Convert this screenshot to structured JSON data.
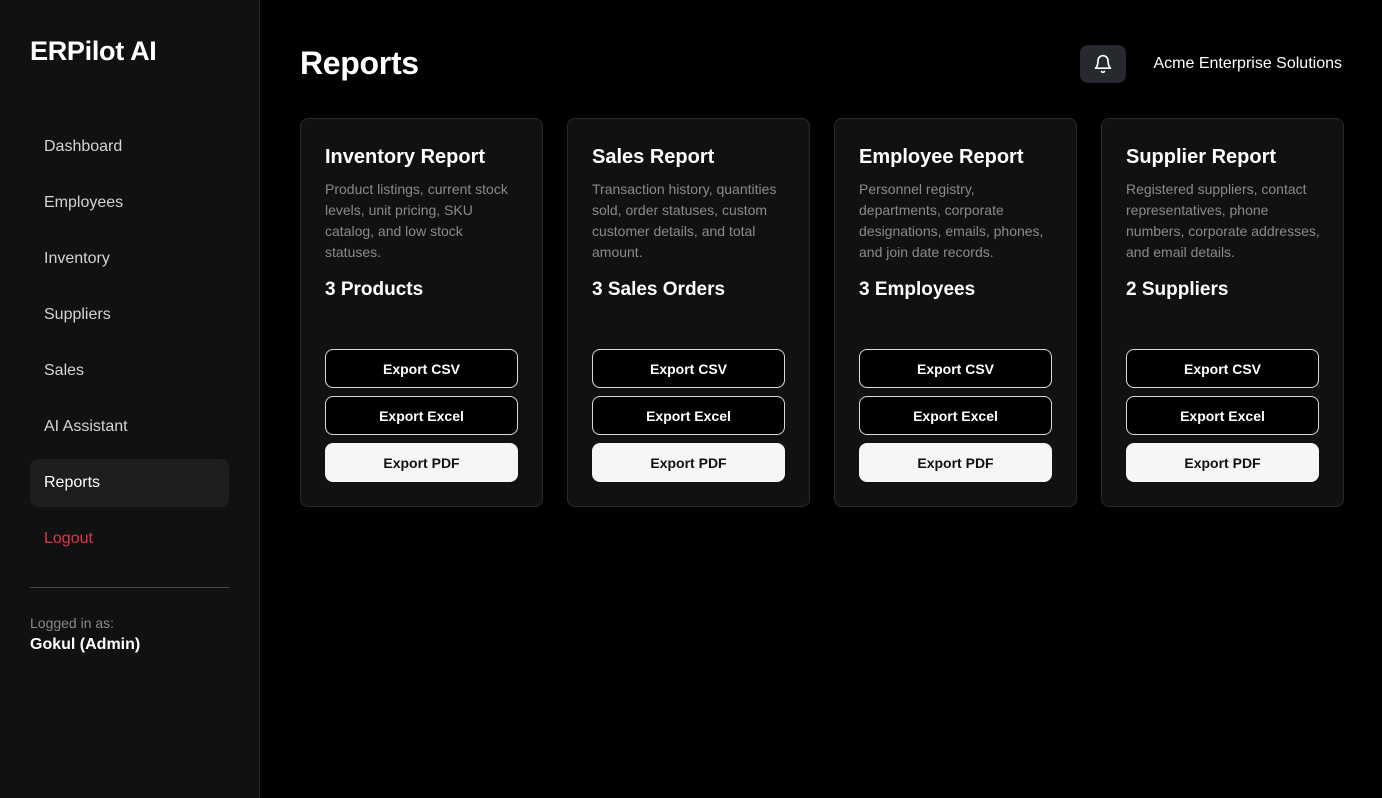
{
  "app": {
    "brand": "ERPilot AI"
  },
  "sidebar": {
    "items": [
      {
        "label": "Dashboard"
      },
      {
        "label": "Employees"
      },
      {
        "label": "Inventory"
      },
      {
        "label": "Suppliers"
      },
      {
        "label": "Sales"
      },
      {
        "label": "AI Assistant"
      },
      {
        "label": "Reports"
      },
      {
        "label": "Logout"
      }
    ],
    "active_item": "Reports",
    "logged_in_label": "Logged in as:",
    "logged_in_user": "Gokul (Admin)"
  },
  "header": {
    "title": "Reports",
    "notification_icon": "bell-icon",
    "company": "Acme Enterprise Solutions"
  },
  "cards": [
    {
      "title": "Inventory Report",
      "description": "Product listings, current stock levels, unit pricing, SKU catalog, and low stock statuses.",
      "count": "3 Products",
      "buttons": {
        "csv": "Export CSV",
        "excel": "Export Excel",
        "pdf": "Export PDF"
      }
    },
    {
      "title": "Sales Report",
      "description": "Transaction history, quantities sold, order statuses, custom customer details, and total amount.",
      "count": "3 Sales Orders",
      "buttons": {
        "csv": "Export CSV",
        "excel": "Export Excel",
        "pdf": "Export PDF"
      }
    },
    {
      "title": "Employee Report",
      "description": "Personnel registry, departments, corporate designations, emails, phones, and join date records.",
      "count": "3 Employees",
      "buttons": {
        "csv": "Export CSV",
        "excel": "Export Excel",
        "pdf": "Export PDF"
      }
    },
    {
      "title": "Supplier Report",
      "description": "Registered suppliers, contact representatives, phone numbers, corporate addresses, and email details.",
      "count": "2 Suppliers",
      "buttons": {
        "csv": "Export CSV",
        "excel": "Export Excel",
        "pdf": "Export PDF"
      }
    }
  ],
  "colors": {
    "background": "#000000",
    "sidebar_bg": "#111111",
    "card_bg": "#111111",
    "logout": "#e0354a",
    "muted_text": "#8a8a8a"
  }
}
